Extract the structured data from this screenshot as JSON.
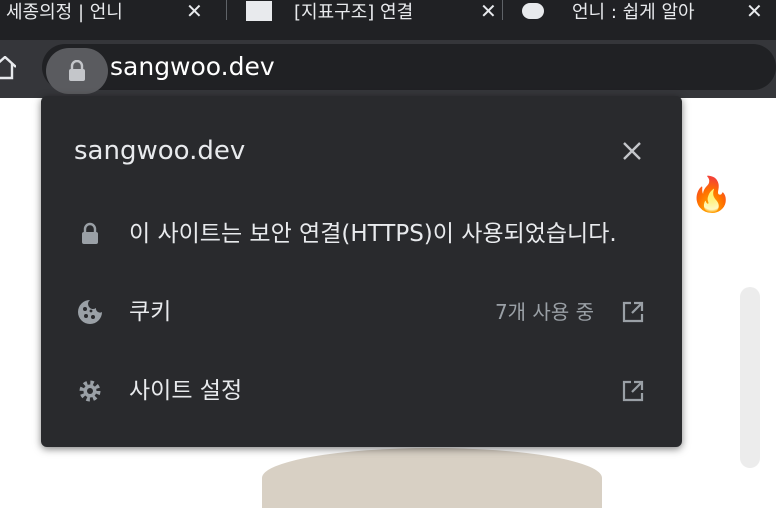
{
  "tabs": [
    {
      "title": "세종의정 | 언니"
    },
    {
      "title": "[지표구조] 연결"
    },
    {
      "title": "언니 : 쉽게 알아"
    }
  ],
  "address_bar": {
    "url": "sangwoo.dev"
  },
  "site_info_popup": {
    "title": "sangwoo.dev",
    "connection_text": "이 사이트는 보안 연결(HTTPS)이 사용되었습니다.",
    "cookies_label": "쿠키",
    "cookies_status": "7개 사용 중",
    "site_settings_label": "사이트 설정"
  },
  "page": {
    "emoji": "🔥"
  },
  "colors": {
    "popup_bg": "#292a2d",
    "toolbar_bg": "#35363a",
    "tabstrip_bg": "#202124",
    "text": "#e8eaed",
    "muted": "#9aa0a6"
  }
}
